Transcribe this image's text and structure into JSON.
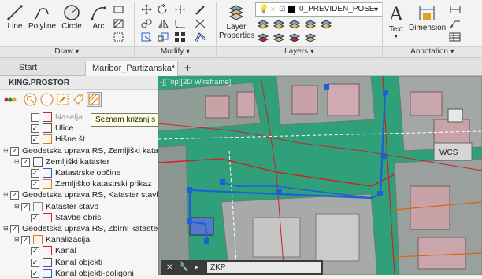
{
  "ribbon": {
    "draw_tools": [
      "Line",
      "Polyline",
      "Circle",
      "Arc"
    ],
    "groups": {
      "draw": "Draw",
      "modify": "Modify",
      "layers": "Layers",
      "annotation": "Annotation"
    },
    "layer_properties_line1": "Layer",
    "layer_properties_line2": "Properties",
    "current_layer": "0_PREVIDEN_POSE",
    "text_tool": "Text",
    "dimension_tool": "Dimension"
  },
  "tabs": [
    "Start",
    "Maribor_Partizanska*"
  ],
  "panel": {
    "title": "KING.PROSTOR",
    "tooltip": "Seznam krizanj s parcelami",
    "tree": [
      {
        "label": "Naselja",
        "level": 2,
        "checked": false,
        "faded": true
      },
      {
        "label": "Ulice",
        "level": 2,
        "checked": true
      },
      {
        "label": "Hišne št.",
        "level": 2,
        "checked": true
      },
      {
        "label": "Geodetska uprava RS, Zemljiški katast",
        "level": 0,
        "checked": true
      },
      {
        "label": "Zemljiški kataster",
        "level": 1,
        "checked": true
      },
      {
        "label": "Katastrske občine",
        "level": 2,
        "checked": true
      },
      {
        "label": "Zemljiško katastrski prikaz",
        "level": 2,
        "checked": true
      },
      {
        "label": "Geodetska uprava RS, Kataster stavb",
        "level": 0,
        "checked": true
      },
      {
        "label": "Kataster stavb",
        "level": 1,
        "checked": true
      },
      {
        "label": "Stavbe obrisi",
        "level": 2,
        "checked": true
      },
      {
        "label": "Geodetska uprava RS, Zbirni kataste",
        "level": 0,
        "checked": true
      },
      {
        "label": "Kanalizacija",
        "level": 1,
        "checked": true
      },
      {
        "label": "Kanal",
        "level": 2,
        "checked": true
      },
      {
        "label": "Kanal objekti",
        "level": 2,
        "checked": true
      },
      {
        "label": "Kanal objekti-poligoni",
        "level": 2,
        "checked": true
      }
    ]
  },
  "viewport": {
    "label": "-][Top][2D Wireframe]",
    "stamp_label": "WCS"
  },
  "command_line": {
    "input_value": "ZKP"
  },
  "colors": {
    "viewport_green": "#2fa07a",
    "parcel_gray": "#9b9b9b",
    "selection_blue": "#1f5fd6",
    "network_red": "#d0202a"
  }
}
